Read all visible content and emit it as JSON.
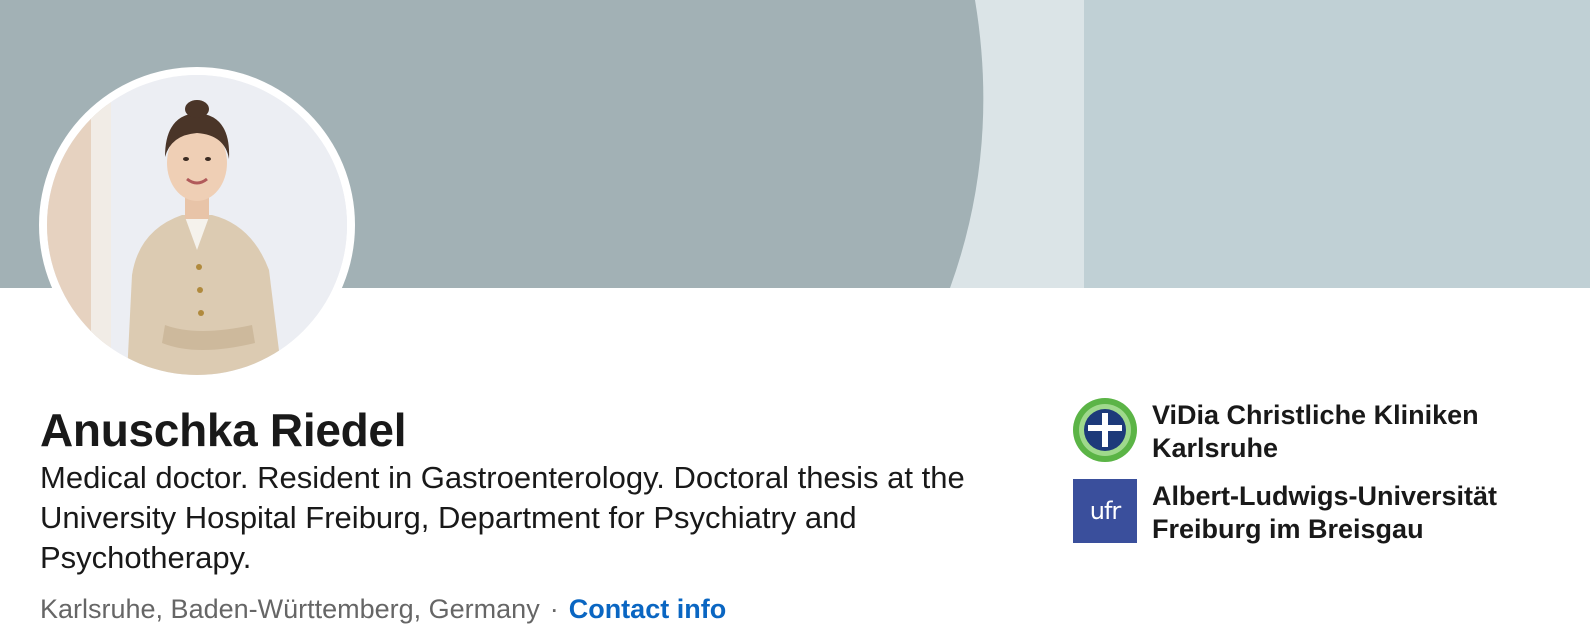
{
  "profile": {
    "name": "Anuschka Riedel",
    "headline": "Medical doctor. Resident in Gastroenterology. Doctoral thesis at the University Hospital Freiburg, Department for Psychiatry and Psychotherapy.",
    "location": "Karlsruhe, Baden-Württemberg, Germany",
    "separator": "·",
    "contact_label": "Contact info"
  },
  "organizations": [
    {
      "name": "ViDia Christliche Kliniken Karlsruhe",
      "logo": "vidia-cross-logo"
    },
    {
      "name": "Albert-Ludwigs-Universität Freiburg im Breisgau",
      "logo": "ufr-logo",
      "logo_text": "ufr"
    }
  ],
  "colors": {
    "banner_dark": "#a2b1b5",
    "banner_mid": "#dbe4e7",
    "banner_light": "#c0d0d5",
    "link": "#0a66c2",
    "text_primary": "#191919",
    "text_secondary": "#666666",
    "ufr_blue": "#3a4f9c",
    "vidia_green": "#5bb446",
    "vidia_navy": "#1d3a7a"
  }
}
